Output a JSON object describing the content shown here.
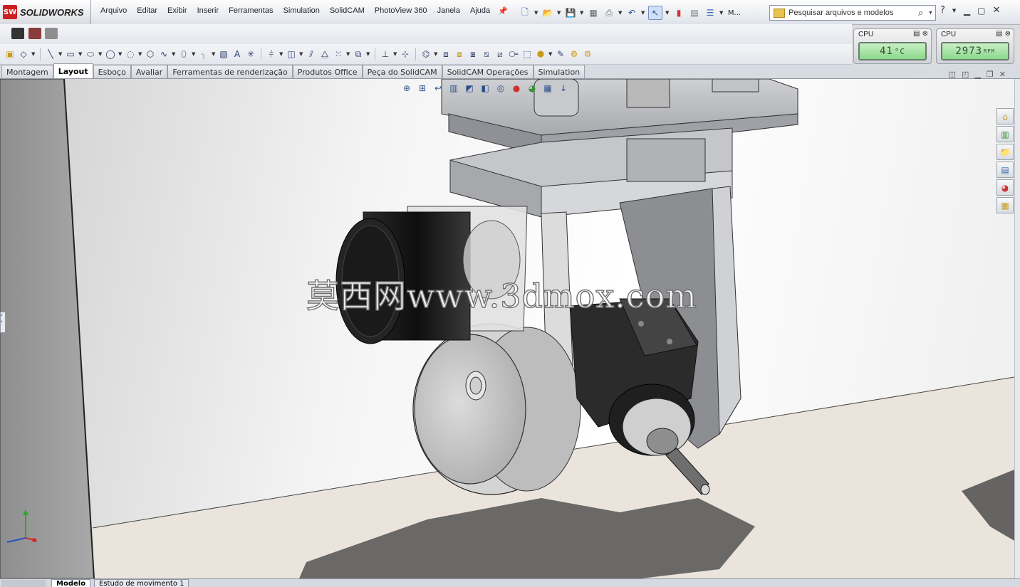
{
  "app": {
    "brand": "SOLIDWORKS",
    "brand_mark": "SW"
  },
  "menu": [
    "Arquivo",
    "Editar",
    "Exibir",
    "Inserir",
    "Ferramentas",
    "Simulation",
    "SolidCAM",
    "PhotoView 360",
    "Janela",
    "Ajuda"
  ],
  "menu_overflow": "M...",
  "search": {
    "placeholder": "Pesquisar arquivos e modelos"
  },
  "help": {
    "icon": "help-icon"
  },
  "gadgets": [
    {
      "label": "CPU",
      "value": "41",
      "unit": "°C"
    },
    {
      "label": "CPU",
      "value": "2973",
      "unit": "RPM"
    }
  ],
  "tabs": [
    "Montagem",
    "Layout",
    "Esboço",
    "Avaliar",
    "Ferramentas de renderização",
    "Produtos Office",
    "Peça do SolidCAM",
    "SolidCAM Operações",
    "Simulation"
  ],
  "active_tab": "Layout",
  "watermark": "莫西网www.3dmox.com",
  "bottom_tabs": [
    "Modelo",
    "Estudo de movimento 1"
  ],
  "colors": {
    "accent": "#1e4b8f",
    "brand_red": "#cc1f1f",
    "lcd": "#8ad88a"
  }
}
